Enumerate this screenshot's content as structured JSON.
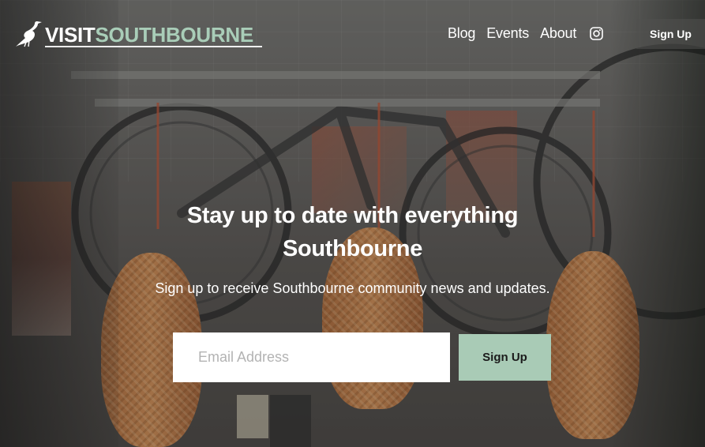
{
  "header": {
    "logo": {
      "visit": "VISIT",
      "town": "SOUTHBOURNE",
      "icon": "heron-icon"
    },
    "nav": [
      {
        "label": "Blog"
      },
      {
        "label": "Events"
      },
      {
        "label": "About"
      }
    ],
    "social_icon": "instagram-icon",
    "signup_label": "Sign Up"
  },
  "hero": {
    "title_line1": "Stay up to date with everything",
    "title_line2": "Southbourne",
    "subtitle": "Sign up to receive Southbourne community news and updates.",
    "email_placeholder": "Email Address",
    "submit_label": "Sign Up"
  },
  "colors": {
    "accent": "#a9cbb6",
    "text": "#ffffff"
  }
}
